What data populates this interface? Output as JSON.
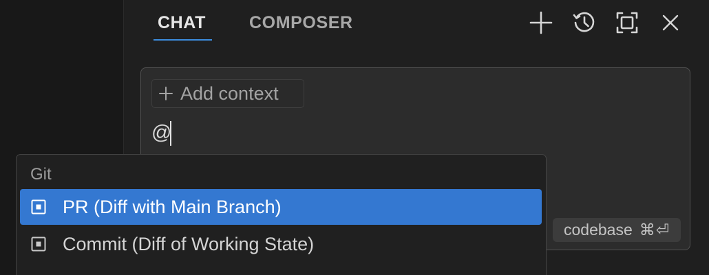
{
  "header": {
    "tabs": [
      {
        "label": "CHAT",
        "active": true
      },
      {
        "label": "COMPOSER",
        "active": false
      }
    ],
    "buttons": [
      {
        "icon": "plus-icon",
        "action": "new-chat"
      },
      {
        "icon": "history-icon",
        "action": "history"
      },
      {
        "icon": "maximize-icon",
        "action": "maximize"
      },
      {
        "icon": "close-icon",
        "action": "close"
      }
    ]
  },
  "input": {
    "add_context_label": "Add context",
    "value": "@",
    "codebase_label": "codebase",
    "codebase_shortcut": "⌘⏎"
  },
  "mention_menu": {
    "section_label": "Git",
    "items": [
      {
        "label": "PR (Diff with Main Branch)",
        "icon": "git-diff-icon",
        "selected": true
      },
      {
        "label": "Commit (Diff of Working State)",
        "icon": "git-diff-icon",
        "selected": false
      }
    ]
  },
  "colors": {
    "accent": "#3c8dde",
    "selected_item": "#3478d1",
    "panel_bg": "#1f1f1f",
    "input_bg": "#2c2c2c",
    "menu_bg": "#202020"
  }
}
